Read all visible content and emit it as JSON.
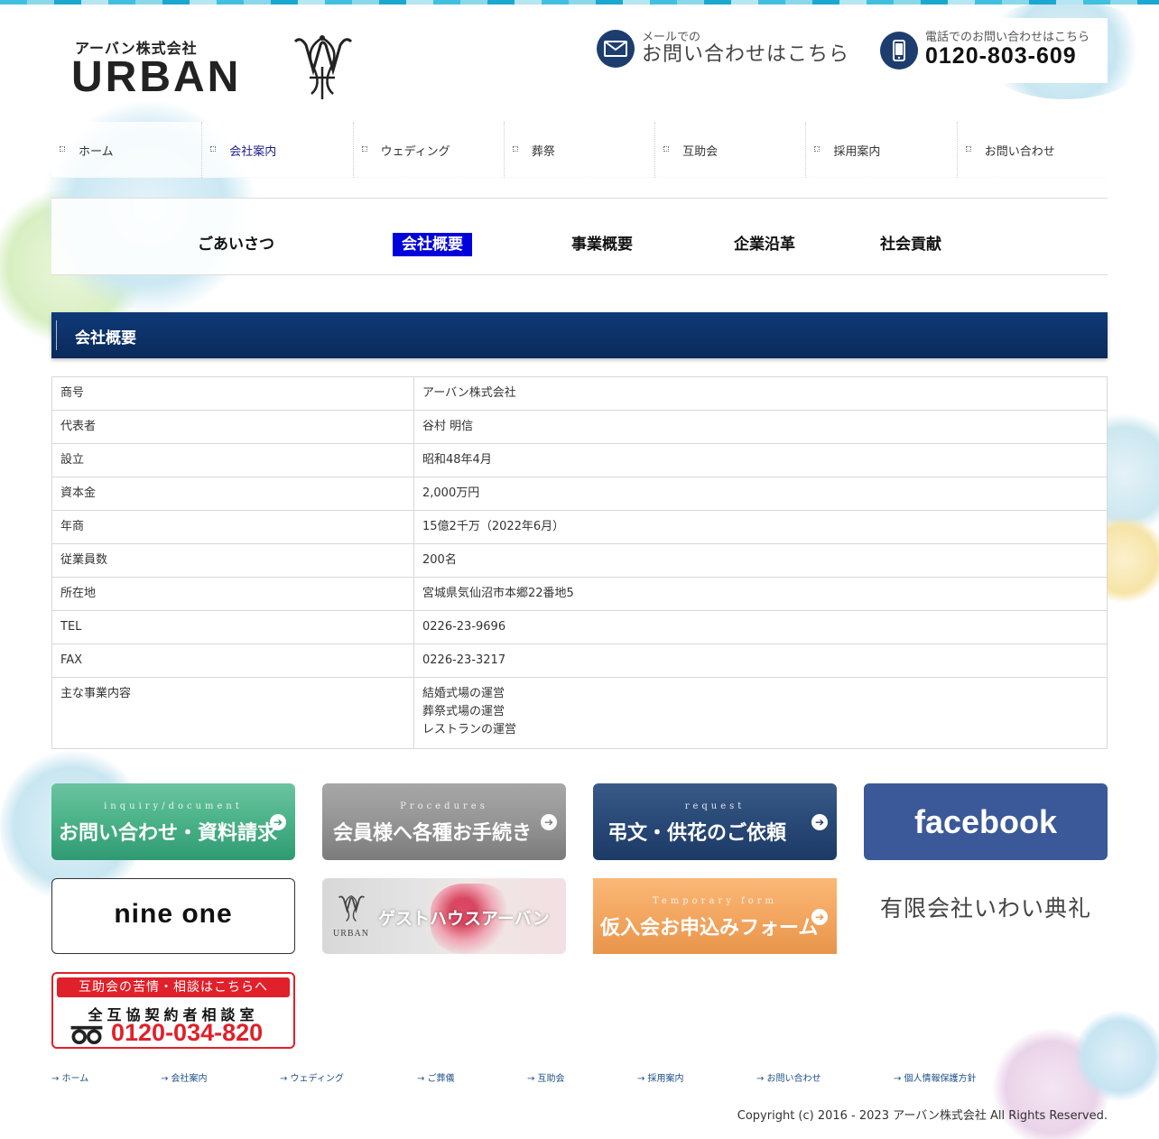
{
  "header": {
    "logo_small": "アーバン株式会社",
    "logo_big": "URBAN",
    "mail_small": "メールでの",
    "mail_big": "お問い合わせはこちら",
    "tel_small": "電話でのお問い合わせはこちら",
    "tel_number": "0120-803-609"
  },
  "nav": {
    "items": [
      {
        "label": "ホーム"
      },
      {
        "label": "会社案内"
      },
      {
        "label": "ウェディング"
      },
      {
        "label": "葬祭"
      },
      {
        "label": "互助会"
      },
      {
        "label": "採用案内"
      },
      {
        "label": "お問い合わせ"
      }
    ],
    "active_index": 1
  },
  "subnav": {
    "items": [
      {
        "label": "ごあいさつ"
      },
      {
        "label": "会社概要"
      },
      {
        "label": "事業概要"
      },
      {
        "label": "企業沿革"
      },
      {
        "label": "社会貢献"
      }
    ],
    "active_index": 1
  },
  "section": {
    "title": "会社概要"
  },
  "company_table": {
    "rows": [
      {
        "key": "商号",
        "value": "アーバン株式会社"
      },
      {
        "key": "代表者",
        "value": "谷村 明信"
      },
      {
        "key": "設立",
        "value": "昭和48年4月"
      },
      {
        "key": "資本金",
        "value": "2,000万円"
      },
      {
        "key": "年商",
        "value": "15億2千万（2022年6月）"
      },
      {
        "key": "従業員数",
        "value": "200名"
      },
      {
        "key": "所在地",
        "value": "宮城県気仙沼市本郷22番地5"
      },
      {
        "key": "TEL",
        "value": "0226-23-9696"
      },
      {
        "key": "FAX",
        "value": "0226-23-3217"
      },
      {
        "key": "主な事業内容",
        "value_lines": [
          "結婚式場の運営",
          "葬祭式場の運営",
          "レストランの運営"
        ]
      }
    ]
  },
  "banners": {
    "inquiry": {
      "sub": "inquiry/document",
      "main": "お問い合わせ・資料請求"
    },
    "procedures": {
      "sub": "Procedures",
      "main": "会員様へ各種お手続き"
    },
    "request": {
      "sub": "request",
      "main": "弔文・供花のご依頼"
    },
    "facebook": {
      "main": "facebook"
    },
    "nineone": {
      "main": "nine one"
    },
    "guesthouse": {
      "main": "ゲストハウスアーバン",
      "logo": "URBAN"
    },
    "temporary": {
      "sub": "Temporary form",
      "main": "仮入会お申込みフォーム"
    },
    "iwai": {
      "main": "有限会社いわい典礼"
    },
    "consult": {
      "line1": "互助会の苦情・相談はこちらへ",
      "line2": "全互協契約者相談室",
      "number": "0120-034-820"
    }
  },
  "footer": {
    "links": [
      {
        "label": "→ ホーム"
      },
      {
        "label": "→ 会社案内"
      },
      {
        "label": "→ ウェディング"
      },
      {
        "label": "→ ご葬儀"
      },
      {
        "label": "→ 互助会"
      },
      {
        "label": "→ 採用案内"
      },
      {
        "label": "→ お問い合わせ"
      },
      {
        "label": "→ 個人情報保護方針"
      }
    ],
    "copyright": "Copyright (c) 2016 - 2023 アーバン株式会社 All Rights Reserved."
  },
  "colors": {
    "navy": "#0a2a5a",
    "active_blue": "#0000dd",
    "inquiry_green": "#2f9a72",
    "procedures_gray": "#8a8a8a",
    "request_navy": "#203f6b",
    "facebook_blue": "#3b5998",
    "temporary_orange": "#f0a35a",
    "consult_red": "#e0202a"
  },
  "icons": [
    "mail-icon",
    "phone-icon",
    "nav-bullet-icon",
    "arrow-right-icon",
    "free-dial-icon"
  ]
}
